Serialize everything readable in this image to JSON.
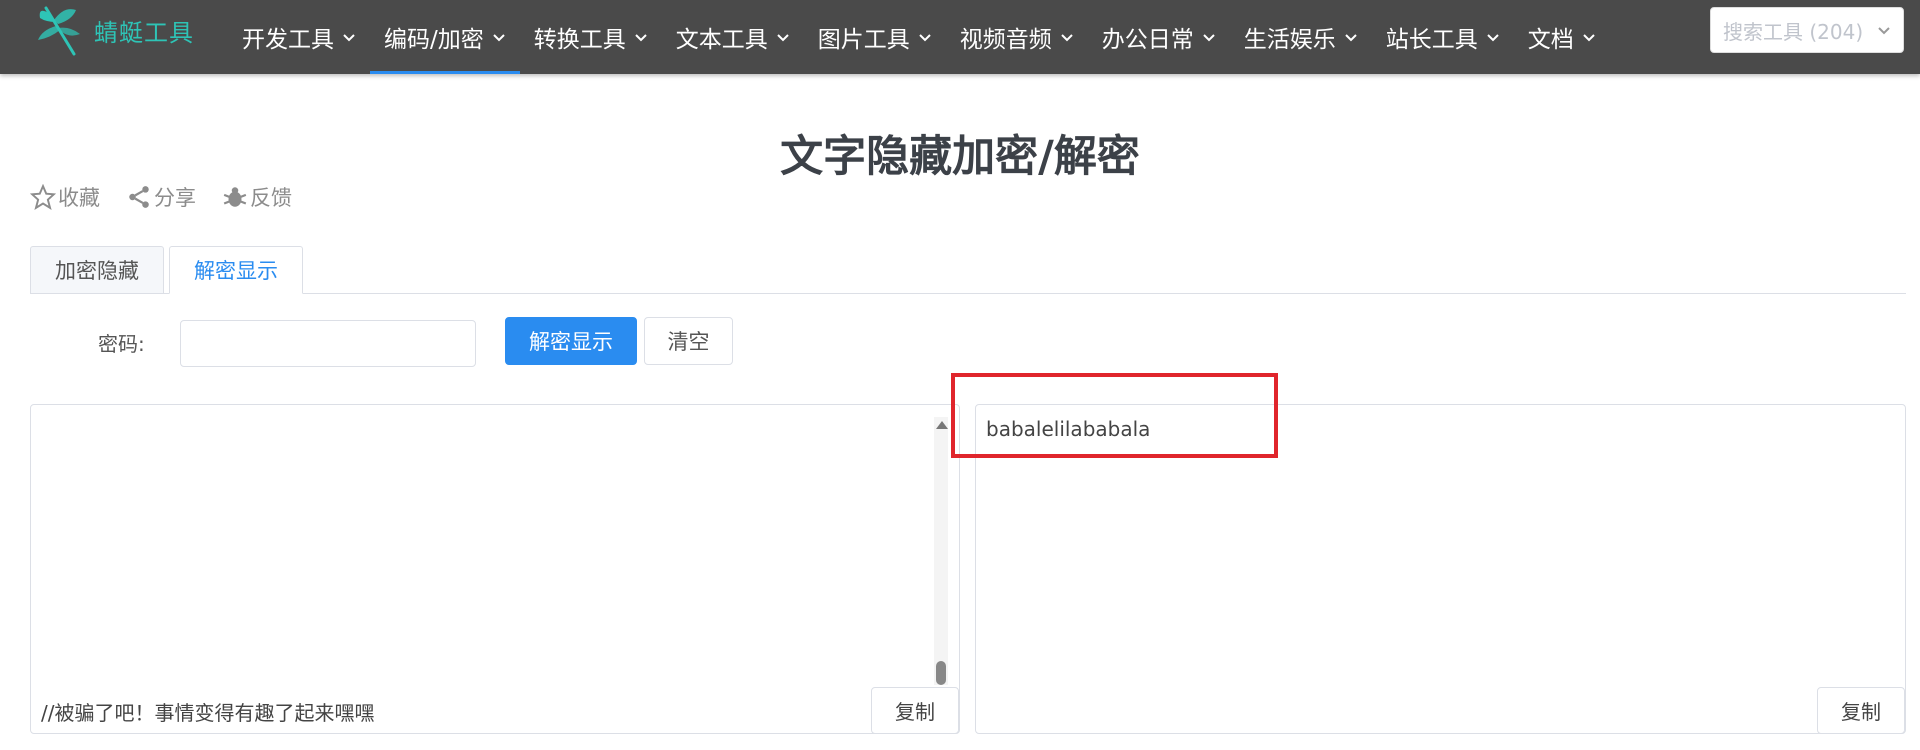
{
  "navbar": {
    "brand": "蜻蜓工具",
    "items": [
      {
        "label": "开发工具"
      },
      {
        "label": "编码/加密",
        "active": true
      },
      {
        "label": "转换工具"
      },
      {
        "label": "文本工具"
      },
      {
        "label": "图片工具"
      },
      {
        "label": "视频音频"
      },
      {
        "label": "办公日常"
      },
      {
        "label": "生活娱乐"
      },
      {
        "label": "站长工具"
      },
      {
        "label": "文档"
      }
    ],
    "search_placeholder": "搜索工具 (204)"
  },
  "page": {
    "title": "文字隐藏加密/解密",
    "actions": {
      "favorite": "收藏",
      "share": "分享",
      "feedback": "反馈"
    }
  },
  "tabs": {
    "encrypt": "加密隐藏",
    "decrypt": "解密显示"
  },
  "form": {
    "password_label": "密码:",
    "password_value": "",
    "decrypt_button": "解密显示",
    "clear_button": "清空"
  },
  "left_panel": {
    "text": "//被骗了吧！事情变得有趣了起来嘿嘿",
    "copy_button": "复制"
  },
  "right_panel": {
    "text": "babalelilababala",
    "copy_button": "复制"
  },
  "colors": {
    "navbar_bg": "#4a4a4a",
    "brand": "#2ec4b6",
    "accent": "#2a8cf0",
    "highlight": "#e0252c"
  }
}
